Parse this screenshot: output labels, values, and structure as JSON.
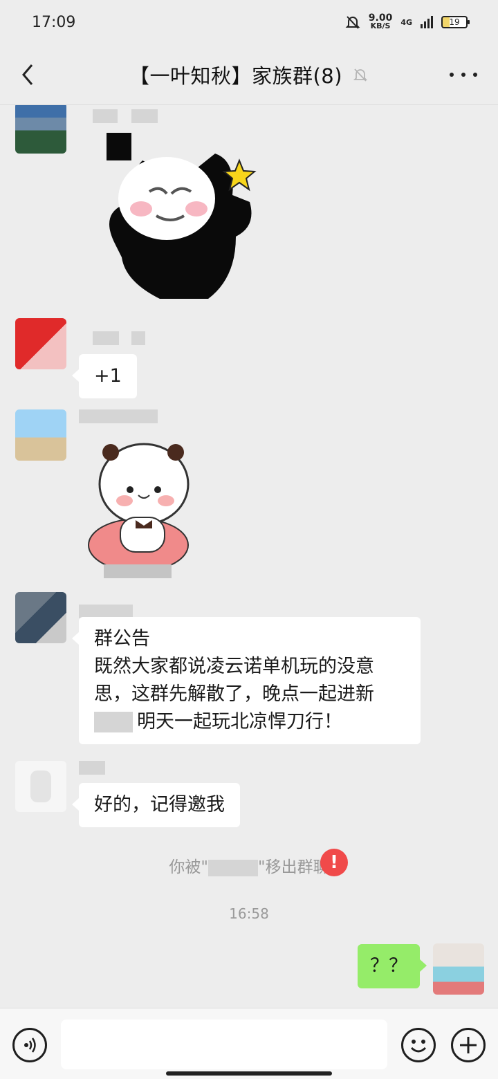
{
  "status_bar": {
    "time": "17:09",
    "net_speed": "9.00",
    "net_unit": "KB/S",
    "network": "4G",
    "battery": "19"
  },
  "nav": {
    "title": "【一叶知秋】家族群(8)"
  },
  "messages": {
    "plus_one": "+1",
    "announce_title": "群公告",
    "announce_line1": "既然大家都说凌云诺单机玩的没意",
    "announce_line2": "思，这群先解散了，晚点一起进新",
    "announce_line3": "明天一起玩北凉悍刀行！",
    "reply": "好的，记得邀我",
    "my_message": "？？"
  },
  "system": {
    "removed_prefix": "你被\"",
    "removed_suffix": "\"移出群聊",
    "time": "16:58"
  },
  "colors": {
    "my_bubble": "#95ec69",
    "error": "#f04a4a",
    "background": "#ededed"
  },
  "icons": [
    "chevron-left-icon",
    "bell-off-icon",
    "more-dots-icon",
    "voice-icon",
    "emoji-icon",
    "plus-icon",
    "error-icon"
  ]
}
